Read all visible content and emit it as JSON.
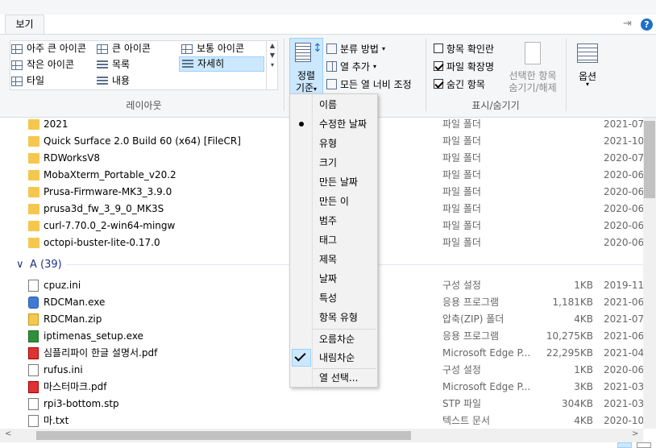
{
  "titlebar": {
    "minimize": "—",
    "maximize": "☐",
    "close": "✕"
  },
  "ribbon": {
    "tab_view": "보기",
    "pin_glyph": "⇥",
    "help_glyph": "?",
    "layout": {
      "items": [
        "아주 큰 아이콘",
        "큰 아이콘",
        "보통 아이콘",
        "작은 아이콘",
        "목록",
        "자세히",
        "타일",
        "내용"
      ],
      "group_label": "레이아웃"
    },
    "current_view": {
      "sort_label_1": "정렬",
      "sort_label_2": "기준",
      "group_by": "분류 방법",
      "add_columns": "열 추가",
      "fit_columns": "모든 열 너비 조정"
    },
    "show_hide": {
      "item_checkbox": "항목 확인란",
      "file_ext": "파일 확장명",
      "hidden_items": "숨긴 항목",
      "hide_selected_1": "선택한 항목",
      "hide_selected_2": "숨기기/해제",
      "group_label": "표시/숨기기"
    },
    "options": "옵션"
  },
  "files": {
    "folders": [
      {
        "name": "2021",
        "type": "파일 폴더",
        "date": "2021-07"
      },
      {
        "name": "Quick Surface 2.0 Build 60 (x64) [FileCR]",
        "type": "파일 폴더",
        "date": "2021-10"
      },
      {
        "name": "RDWorksV8",
        "type": "파일 폴더",
        "date": "2020-07"
      },
      {
        "name": "MobaXterm_Portable_v20.2",
        "type": "파일 폴더",
        "date": "2020-06"
      },
      {
        "name": "Prusa-Firmware-MK3_3.9.0",
        "type": "파일 폴더",
        "date": "2020-06"
      },
      {
        "name": "prusa3d_fw_3_9_0_MK3S",
        "type": "파일 폴더",
        "date": "2020-06"
      },
      {
        "name": "curl-7.70.0_2-win64-mingw",
        "type": "파일 폴더",
        "date": "2020-06"
      },
      {
        "name": "octopi-buster-lite-0.17.0",
        "type": "파일 폴더",
        "date": "2020-06"
      }
    ],
    "group_a": "A (39)",
    "group_chevron": "∨",
    "items": [
      {
        "name": "cpuz.ini",
        "type": "구성 설정",
        "size": "1KB",
        "date": "2019-11",
        "icon": "ini"
      },
      {
        "name": "RDCMan.exe",
        "type": "응용 프로그램",
        "size": "1,181KB",
        "date": "2021-06",
        "icon": "exe"
      },
      {
        "name": "RDCMan.zip",
        "type": "압축(ZIP) 폴더",
        "size": "4KB",
        "date": "2021-07",
        "icon": "zip"
      },
      {
        "name": "iptimenas_setup.exe",
        "type": "응용 프로그램",
        "size": "10,275KB",
        "date": "2021-06",
        "icon": "setup"
      },
      {
        "name": "심플리파이 한글 설명서.pdf",
        "type": "Microsoft Edge P...",
        "size": "22,295KB",
        "date": "2021-04",
        "icon": "pdf"
      },
      {
        "name": "rufus.ini",
        "type": "구성 설정",
        "size": "1KB",
        "date": "2020-06",
        "icon": "ini"
      },
      {
        "name": "마스터마크.pdf",
        "type": "Microsoft Edge P...",
        "size": "3KB",
        "date": "2021-03",
        "icon": "pdf"
      },
      {
        "name": "rpi3-bottom.stp",
        "type": "STP 파일",
        "size": "304KB",
        "date": "2021-03",
        "icon": "file"
      },
      {
        "name": "마.txt",
        "type": "텍스트 문서",
        "size": "4KB",
        "date": "2020-10",
        "icon": "txt"
      }
    ]
  },
  "sort_menu": {
    "items": [
      "이름",
      "수정한 날짜",
      "유형",
      "크기",
      "만든 날짜",
      "만든 이",
      "범주",
      "태그",
      "제목",
      "날짜",
      "특성",
      "항목 유형"
    ],
    "asc": "오름차순",
    "desc": "내림차순",
    "choose_columns": "열 선택..."
  },
  "colors": {
    "accent": "#cce8ff",
    "accent_border": "#99d1ff",
    "folder": "#f5c74f",
    "group_header": "#1e3287"
  }
}
